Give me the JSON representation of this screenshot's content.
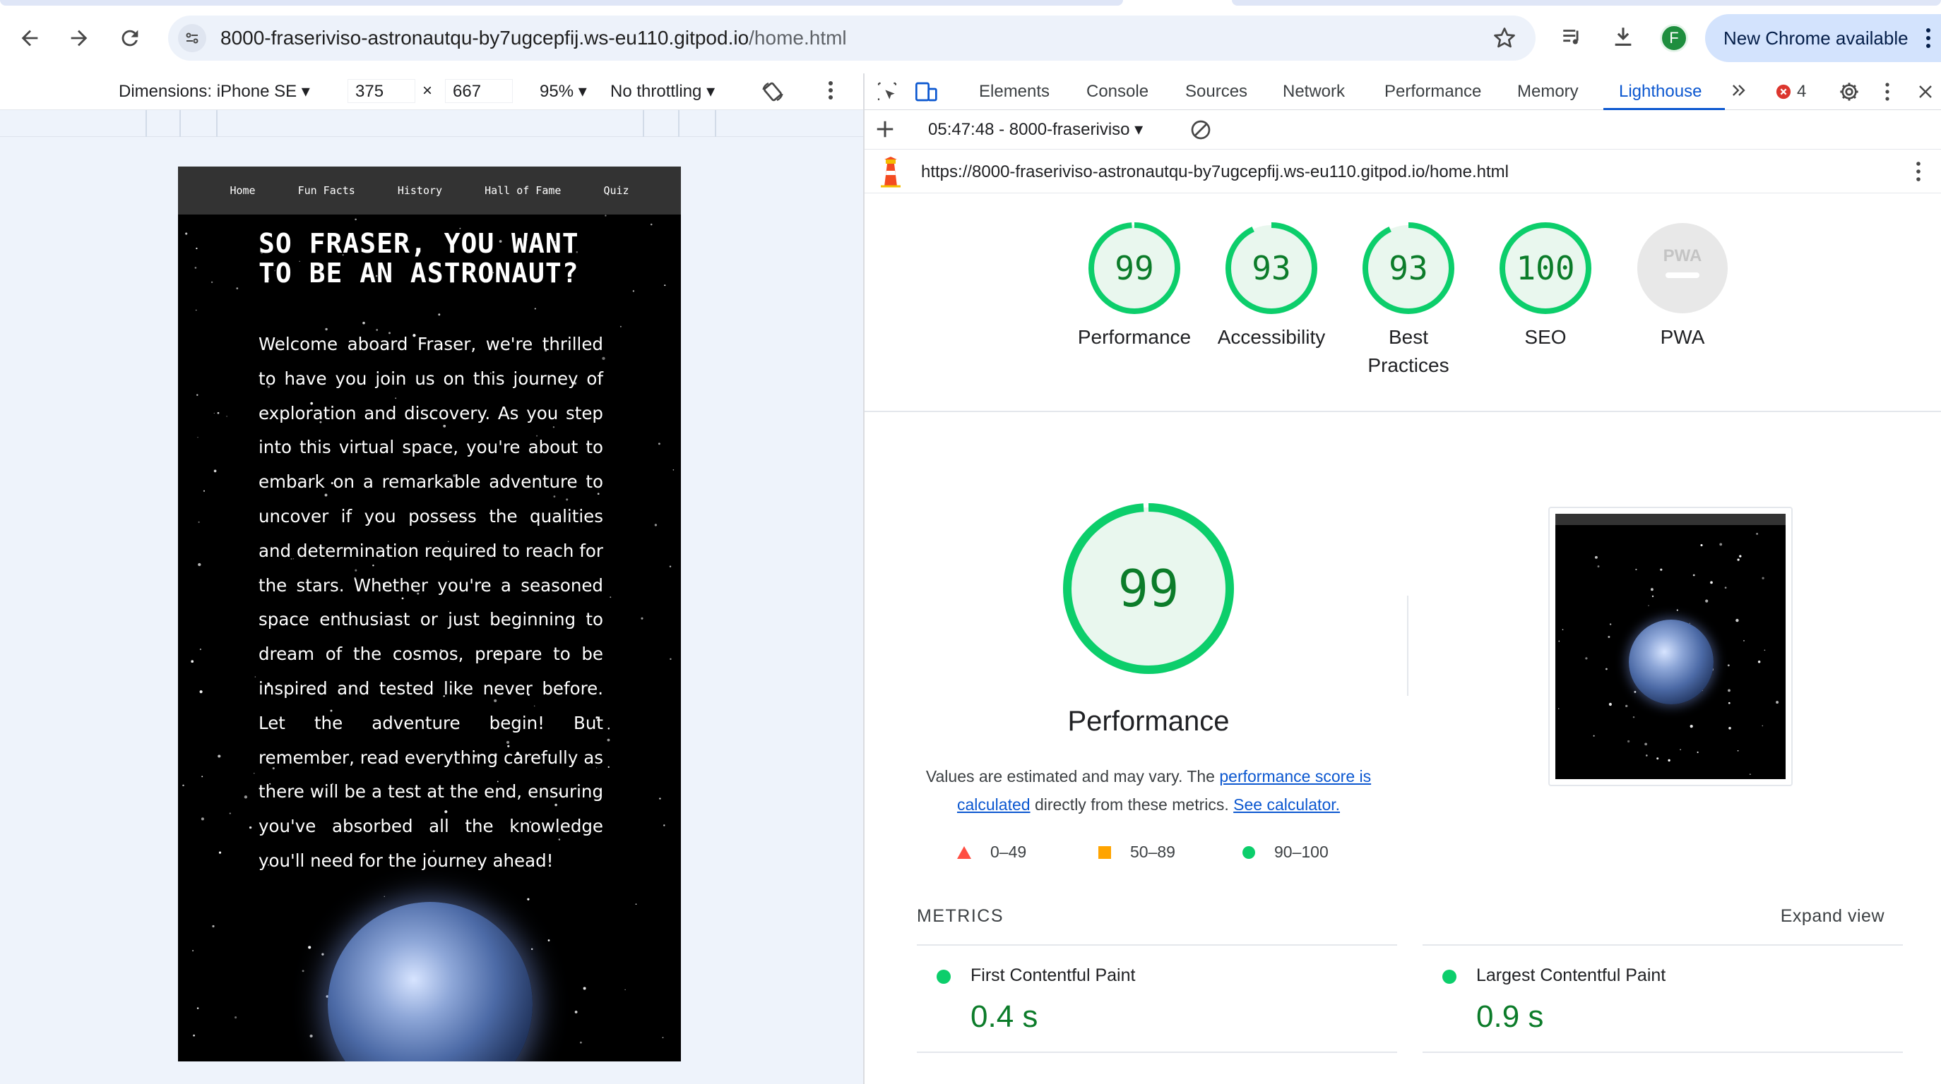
{
  "browser": {
    "url_host": "8000-fraseriviso-astronautqu-by7ugcepfij.ws-eu110.gitpod.io",
    "url_path": "/home.html",
    "avatar_initial": "F",
    "update_label": "New Chrome available",
    "icons": [
      "back-icon",
      "forward-icon",
      "reload-icon",
      "site-settings-icon",
      "bookmark-star-icon",
      "media-queue-icon",
      "download-icon",
      "kebab-menu-icon"
    ]
  },
  "emulation": {
    "dimensions_label": "Dimensions: iPhone SE",
    "width": "375",
    "times": "×",
    "height": "667",
    "zoom": "95%",
    "throttling": "No throttling"
  },
  "site": {
    "nav": [
      "Home",
      "Fun Facts",
      "History",
      "Hall of Fame",
      "Quiz"
    ],
    "title": "SO FRASER, YOU WANT TO BE AN ASTRONAUT?",
    "body": "Welcome aboard Fraser, we're thrilled to have you join us on this journey of exploration and discovery. As you step into this virtual space, you're about to embark on a remarkable adventure to uncover if you possess the qualities and determination required to reach for the stars. Whether you're a seasoned space enthusiast or just beginning to dream of the cosmos, prepare to be inspired and tested like never before. Let the adventure begin! But remember, read everything carefully as there will be a test at the end, ensuring you've absorbed all the knowledge you'll need for the journey ahead!"
  },
  "devtools": {
    "tabs": [
      "Elements",
      "Console",
      "Sources",
      "Network",
      "Performance",
      "Memory",
      "Lighthouse"
    ],
    "active_tab": "Lighthouse",
    "error_count": "4",
    "report_selector": "05:47:48 - 8000-fraseriviso",
    "report_url": "https://8000-fraseriviso-astronautqu-by7ugcepfij.ws-eu110.gitpod.io/home.html"
  },
  "lighthouse": {
    "scores": [
      {
        "label": "Performance",
        "score": 99
      },
      {
        "label": "Accessibility",
        "score": 93
      },
      {
        "label": "Best Practices",
        "score": 93
      },
      {
        "label": "SEO",
        "score": 100
      },
      {
        "label": "PWA",
        "score": null
      }
    ],
    "pwa_badge": "PWA",
    "performance": {
      "score": "99",
      "title": "Performance",
      "desc_prefix": "Values are estimated and may vary. The ",
      "desc_link1": "performance score is calculated",
      "desc_middle": " directly from these metrics. ",
      "desc_link2": "See calculator."
    },
    "legend": {
      "poor": "0–49",
      "average": "50–89",
      "good": "90–100"
    },
    "metrics_heading": "METRICS",
    "expand_label": "Expand view",
    "metrics": [
      {
        "name": "First Contentful Paint",
        "value": "0.4 s"
      },
      {
        "name": "Largest Contentful Paint",
        "value": "0.9 s"
      }
    ],
    "colors": {
      "good": "#0cce6b",
      "average": "#ffa400",
      "poor": "#ff4e42",
      "good_text": "#0c7c2a"
    }
  }
}
